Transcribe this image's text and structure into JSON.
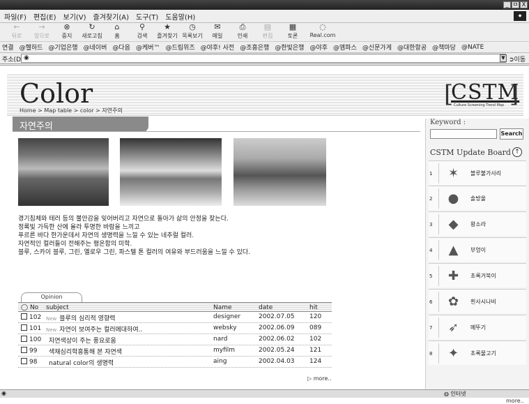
{
  "window": {
    "controls": [
      "_",
      "ㅁ",
      "X"
    ]
  },
  "menu": [
    "파일(F)",
    "편집(E)",
    "보기(V)",
    "즐겨찾기(A)",
    "도구(T)",
    "도움말(H)"
  ],
  "toolbar": [
    {
      "label": "뒤로",
      "icon": "back-icon",
      "disabled": true
    },
    {
      "label": "앞으로",
      "icon": "forward-icon",
      "disabled": true
    },
    {
      "label": "중지",
      "icon": "stop-icon"
    },
    {
      "label": "새로고침",
      "icon": "refresh-icon"
    },
    {
      "label": "홈",
      "icon": "home-icon"
    },
    {
      "label": "검색",
      "icon": "search-icon"
    },
    {
      "label": "즐겨찾기",
      "icon": "favorites-icon"
    },
    {
      "label": "목록보기",
      "icon": "history-icon"
    },
    {
      "label": "메일",
      "icon": "mail-icon"
    },
    {
      "label": "인쇄",
      "icon": "print-icon"
    },
    {
      "label": "편집",
      "icon": "edit-icon",
      "disabled": true
    },
    {
      "label": "토론",
      "icon": "discuss-icon"
    },
    {
      "label": "Real.com",
      "icon": "realcom-icon"
    }
  ],
  "links": [
    "연결",
    "@헬하드",
    "@기업은행",
    "@네이버",
    "@다음",
    "@케버™",
    "@드림위즈",
    "@야후! 사전",
    "@조흥은행",
    "@한빛은행",
    "@야후",
    "@엠파스",
    "@신문가게",
    "@대한항공",
    "@책마당",
    "@NATE"
  ],
  "address": {
    "label": "주소(D)",
    "value": "",
    "go": "이동"
  },
  "site": {
    "logo": "Color",
    "breadcrumb": "Home > Map table > color > 자연주의",
    "cstm": "CSTM",
    "cstm_sub": "Culture Screening Trend Map",
    "section": "자연주의",
    "description": [
      "경기침체와 테러 등의 불안감을 잊어버리고 자연으로 돌아가 삶의 안정을 찾는다.",
      "정록빛 가득한 산에 올라 투명한 바람을 느끼고",
      "푸르른 바다 한가운데서 자연의 생명력을 느낄 수 있는 네추럴 컬러.",
      "자연적인 컬러들이 전해주는 평온함의 미학.",
      "블루, 스카이 블루, 그린, 옐로우 그린, 파스텔 톤 컬러의 여유와 부드러움을 느낄 수 있다."
    ],
    "opinion_tab": "Opinion",
    "table": {
      "headers": {
        "no": "No",
        "subject": "subject",
        "name": "Name",
        "date": "date",
        "hit": "hit"
      },
      "rows": [
        {
          "no": "102",
          "new": "New",
          "subject": "블루의 심리적 영향력",
          "name": "designer",
          "date": "2002.07.05",
          "hit": "120"
        },
        {
          "no": "101",
          "new": "New",
          "subject": "자연이 보여주는 컬러에대하여..",
          "name": "websky",
          "date": "2002.06.09",
          "hit": "089"
        },
        {
          "no": "100",
          "new": "",
          "subject": "자연색상이 주는 풍요로움",
          "name": "nard",
          "date": "2002.06.02",
          "hit": "102"
        },
        {
          "no": "99",
          "new": "",
          "subject": "색채심리학흥통해 본 자연색",
          "name": "myfilm",
          "date": "2002.05.24",
          "hit": "121"
        },
        {
          "no": "98",
          "new": "",
          "subject": "natural color의 생명력",
          "name": "aing",
          "date": "2002.04.03",
          "hit": "124"
        }
      ]
    },
    "more": "more..",
    "keyword": {
      "label": "Keyword :",
      "placeholder": "",
      "button": "Search"
    },
    "update_board": {
      "title": "CSTM Update Board",
      "items": [
        {
          "num": "1",
          "label": "블루불가사리",
          "icon": "starfish-icon",
          "glyph": "✶"
        },
        {
          "num": "2",
          "label": "솔방울",
          "icon": "pinecone-icon",
          "glyph": "●"
        },
        {
          "num": "3",
          "label": "왕소라",
          "icon": "conch-shell-icon",
          "glyph": "◆"
        },
        {
          "num": "4",
          "label": "부엉이",
          "icon": "owl-icon",
          "glyph": "▲"
        },
        {
          "num": "5",
          "label": "초록거북이",
          "icon": "turtle-icon",
          "glyph": "✚"
        },
        {
          "num": "6",
          "label": "흰사시나비",
          "icon": "butterfly-icon",
          "glyph": "✿"
        },
        {
          "num": "7",
          "label": "메뚜기",
          "icon": "grasshopper-icon",
          "glyph": "➶"
        },
        {
          "num": "8",
          "label": "초록물고기",
          "icon": "fish-icon",
          "glyph": "✦"
        }
      ]
    }
  },
  "status": {
    "zone": "인터넷"
  }
}
